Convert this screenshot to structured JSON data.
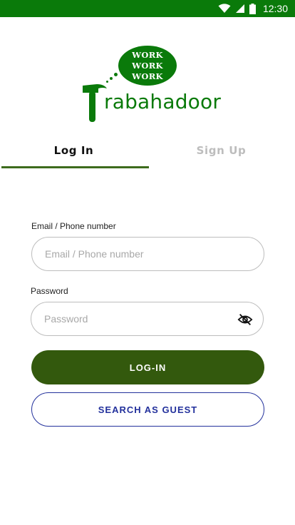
{
  "status_bar": {
    "time": "12:30",
    "icons": [
      "wifi-icon",
      "signal-icon",
      "battery-icon"
    ],
    "background": "#0a7a0a"
  },
  "logo": {
    "bubble_lines": [
      "WORK",
      "WORK",
      "WORK"
    ],
    "word": "rabahadoor",
    "color": "#0a7a0a"
  },
  "tabs": [
    {
      "label": "Log In",
      "active": true
    },
    {
      "label": "Sign Up",
      "active": false
    }
  ],
  "form": {
    "email_label": "Email / Phone number",
    "email_placeholder": "Email / Phone number",
    "email_value": "",
    "password_label": "Password",
    "password_placeholder": "Password",
    "password_value": "",
    "visibility_icon": "eye-off-icon"
  },
  "buttons": {
    "login": "LOG-IN",
    "guest": "SEARCH AS GUEST"
  },
  "colors": {
    "accent": "#33590d",
    "guest_outline": "#23319c",
    "inactive_tab": "#bdbdbd"
  }
}
